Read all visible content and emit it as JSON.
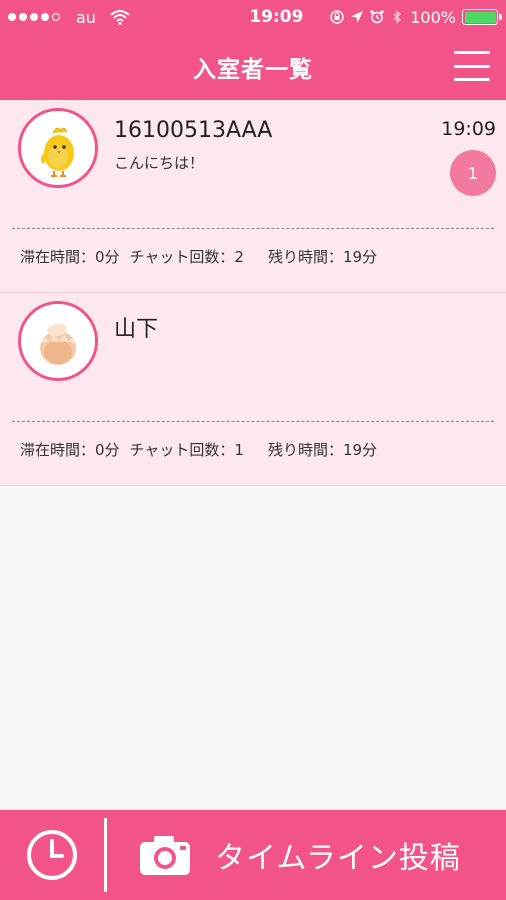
{
  "status_bar": {
    "carrier": "au",
    "time": "19:09",
    "battery": "100%",
    "battery_level": 1.0,
    "battery_color": "#4cd964"
  },
  "header": {
    "title": "入室者一覧",
    "menu_icon": "hamburger-menu-icon"
  },
  "theme": {
    "accent": "#f2548a",
    "card_background": "#fde8ef",
    "badge_color": "#f27a9f"
  },
  "rooms": [
    {
      "name": "16100513AAA",
      "message": "こんにちは！",
      "time": "19:09",
      "unread": "1",
      "avatar": "chick-avatar-icon",
      "stay": "滞在時間：0分",
      "chats": "チャット回数：2",
      "remaining": "残り時間：19分"
    },
    {
      "name": "山下",
      "message": "",
      "time": "",
      "unread": "",
      "avatar": "egg-avatar-icon",
      "stay": "滞在時間：0分",
      "chats": "チャット回数：1",
      "remaining": "残り時間：19分"
    }
  ],
  "bottom_bar": {
    "clock_icon": "clock-icon",
    "camera_icon": "camera-icon",
    "post_label": "タイムライン投稿"
  }
}
